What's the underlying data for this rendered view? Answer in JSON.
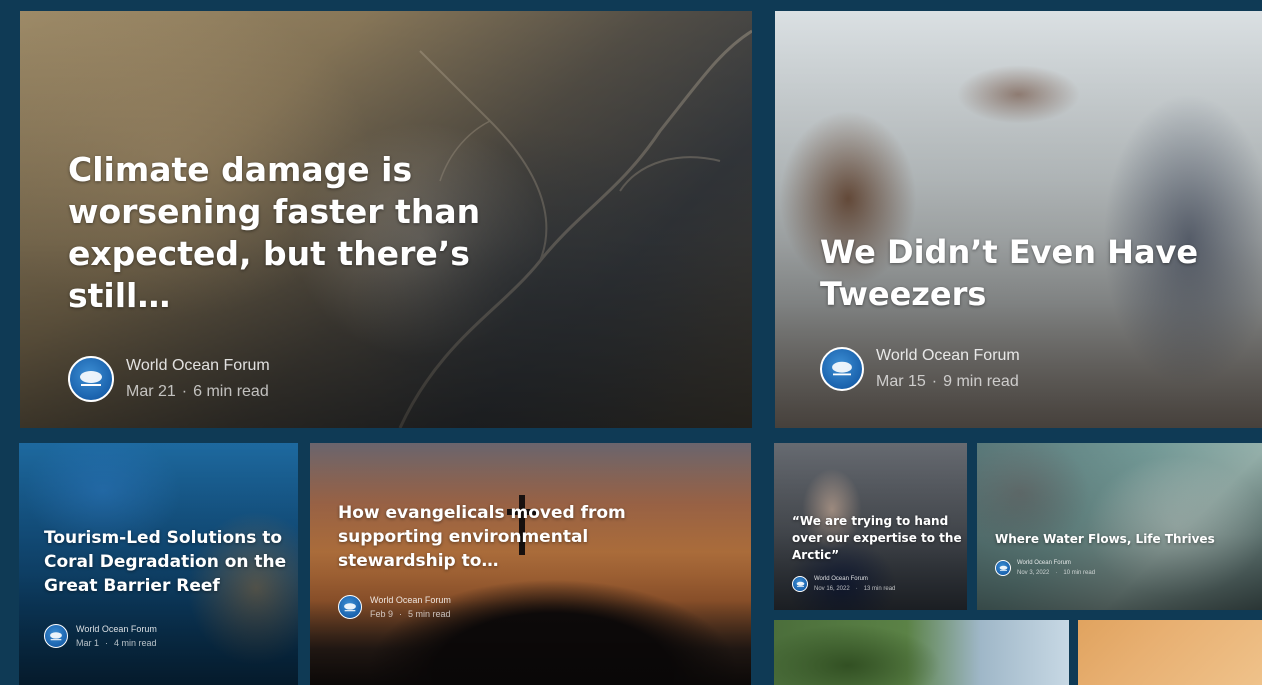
{
  "articles": [
    {
      "title": "Climate damage is worsening faster than expected, but there’s still…",
      "author": "World Ocean Forum",
      "date": "Mar 21",
      "read_time": "6 min read"
    },
    {
      "title": "We Didn’t Even Have Tweezers",
      "author": "World Ocean Forum",
      "date": "Mar 15",
      "read_time": "9 min read"
    },
    {
      "title": "Tourism-Led Solutions to Coral Degradation on the Great Barrier Reef",
      "author": "World Ocean Forum",
      "date": "Mar 1",
      "read_time": "4 min read"
    },
    {
      "title": "How evangelicals moved from supporting environmental stewardship to…",
      "author": "World Ocean Forum",
      "date": "Feb 9",
      "read_time": "5 min read"
    },
    {
      "title": "“We are trying to hand over our expertise to the Arctic”",
      "author": "World Ocean Forum",
      "date": "Nov 16, 2022",
      "read_time": "13 min read"
    },
    {
      "title": "Where Water Flows, Life Thrives",
      "author": "World Ocean Forum",
      "date": "Nov 3, 2022",
      "read_time": "10 min read"
    }
  ],
  "separator": "·",
  "colors": {
    "page_background": "#0f3a55",
    "logo_blue": "#1a62ad",
    "text": "#ffffff"
  },
  "icons": {
    "publisher_logo": "world-ocean-forum-logo-icon",
    "card_7_image": "trees-image",
    "card_8_image": "sunset-image"
  }
}
